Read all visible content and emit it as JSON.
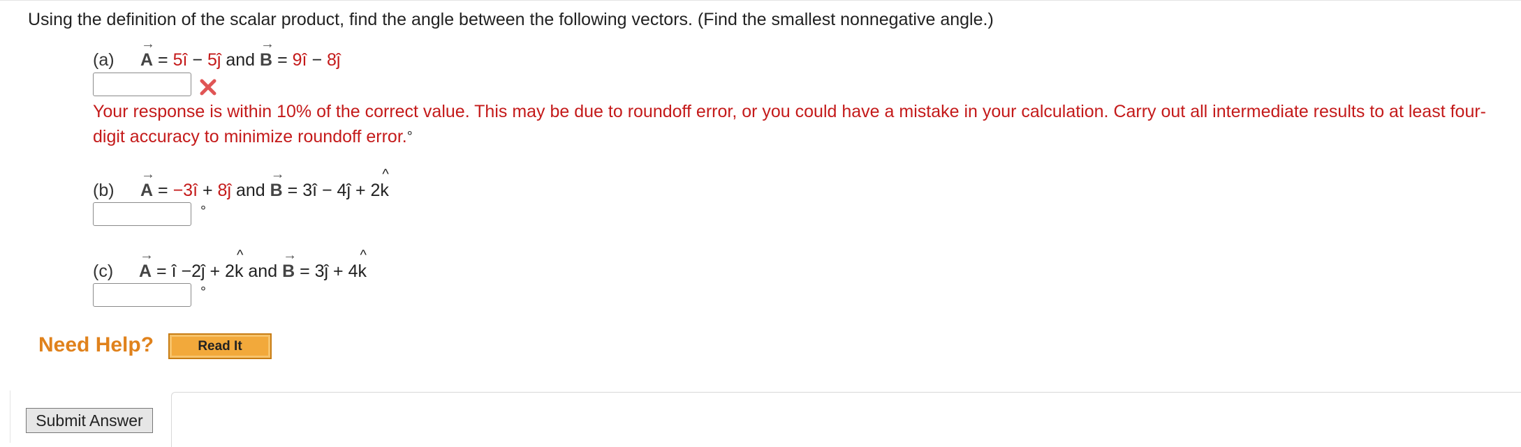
{
  "question": "Using the definition of the scalar product, find the angle between the following vectors. (Find the smallest nonnegative angle.)",
  "parts": {
    "a": {
      "label": "(a)",
      "A_name": "A",
      "eq": "=",
      "A_x": "5î",
      "A_sep": "−",
      "A_y": "5ĵ",
      "and": "and",
      "B_name": "B",
      "B_x": "9î",
      "B_sep": "−",
      "B_y": "8ĵ",
      "answer_value": "",
      "status": "incorrect",
      "feedback": "Your response is within 10% of the correct value. This may be due to roundoff error, or you could have a mistake in your calculation. Carry out all intermediate results to at least four-digit accuracy to minimize roundoff error.",
      "unit": "°"
    },
    "b": {
      "label": "(b)",
      "A_name": "A",
      "eq": "=",
      "A_x": "−3î",
      "A_sep": "+",
      "A_y": "8ĵ",
      "and": "and",
      "B_name": "B",
      "B_rest": "3î − 4ĵ + 2",
      "k": "k",
      "answer_value": "",
      "unit": "°"
    },
    "c": {
      "label": "(c)",
      "A_name": "A",
      "eq": "=",
      "A_rest": "î −2ĵ + 2",
      "k": "k",
      "and": "and",
      "B_name": "B",
      "B_rest": "3ĵ + 4",
      "answer_value": "",
      "unit": "°"
    }
  },
  "arrow": "→",
  "hat": "^",
  "help": {
    "label": "Need Help?",
    "read_it": "Read It"
  },
  "submit_label": "Submit Answer",
  "colors": {
    "given_value": "#c41a1a",
    "help": "#e0821c",
    "read_it_bg": "#f2a93b",
    "error": "#c41a1a"
  },
  "icons": {
    "incorrect": "x-mark-icon"
  }
}
